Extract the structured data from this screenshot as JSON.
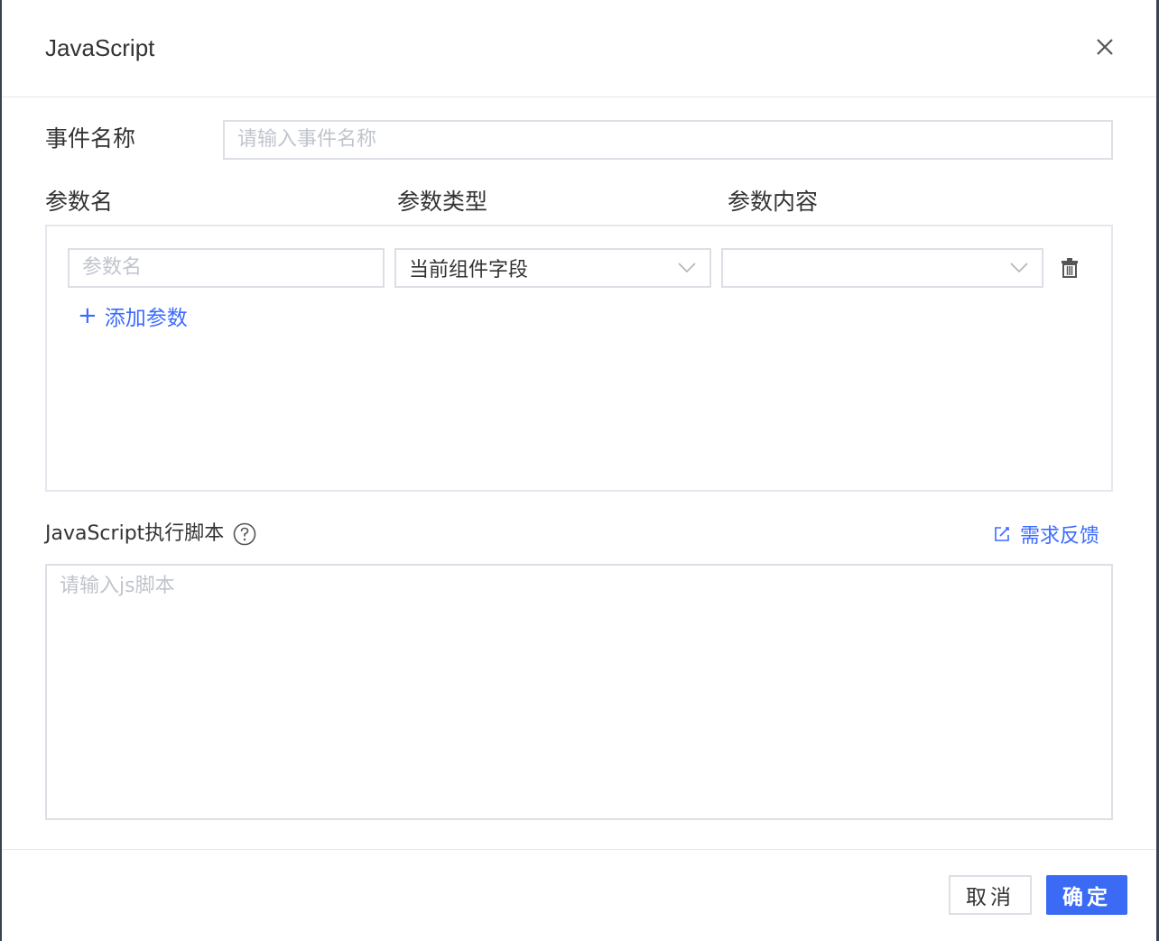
{
  "dialog": {
    "title": "JavaScript",
    "close_icon": "close-icon"
  },
  "event_name": {
    "label": "事件名称",
    "placeholder": "请输入事件名称",
    "value": ""
  },
  "params": {
    "headers": [
      "参数名",
      "参数类型",
      "参数内容"
    ],
    "rows": [
      {
        "name_placeholder": "参数名",
        "name_value": "",
        "type_value": "当前组件字段",
        "content_value": ""
      }
    ],
    "add_label": "添加参数",
    "add_icon": "plus-icon",
    "delete_icon": "trash-icon"
  },
  "script": {
    "label": "JavaScript执行脚本",
    "help_icon": "question-circle-icon",
    "feedback_label": "需求反馈",
    "feedback_icon": "edit-icon",
    "placeholder": "请输入js脚本",
    "value": ""
  },
  "footer": {
    "cancel_label": "取消",
    "ok_label": "确定"
  },
  "colors": {
    "accent": "#3b6bf5",
    "link": "#3b6bff",
    "border": "#dcdfe6",
    "placeholder": "#c0c4cc"
  }
}
